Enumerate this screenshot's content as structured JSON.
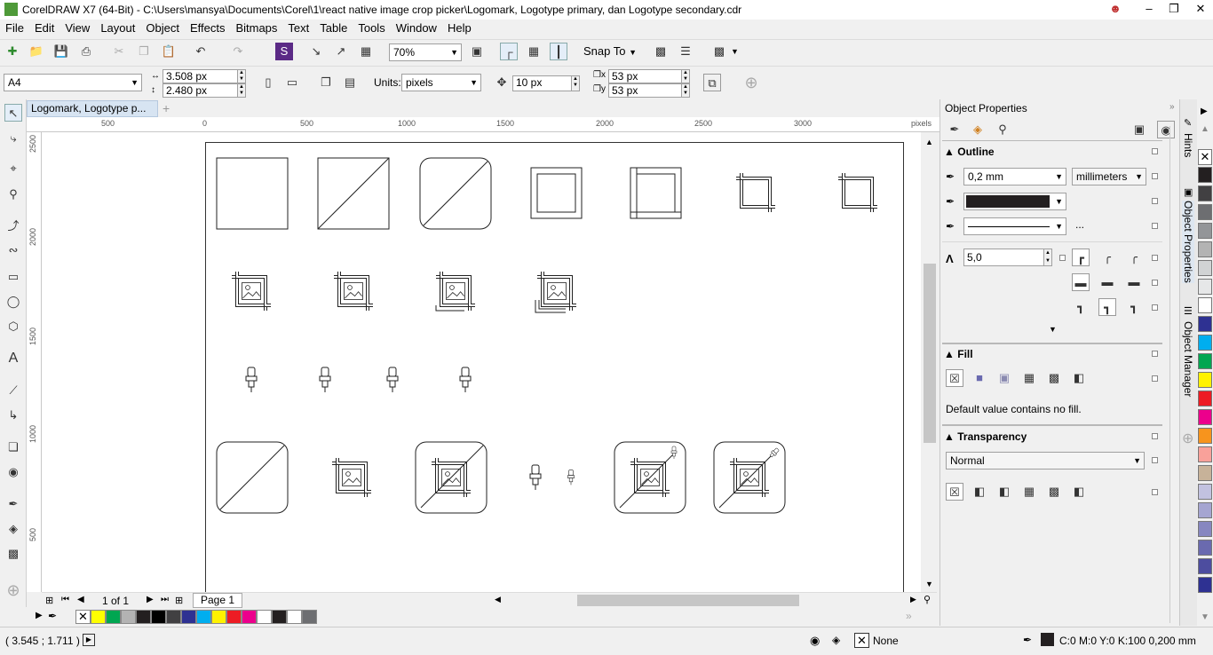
{
  "window": {
    "title": "CorelDRAW X7 (64-Bit) - C:\\Users\\mansya\\Documents\\Corel\\1\\react native image crop picker\\Logomark, Logotype primary, dan Logotype secondary.cdr",
    "controls": [
      "person-icon",
      "minimize-icon",
      "restore-icon",
      "close-icon"
    ]
  },
  "menu": [
    "File",
    "Edit",
    "View",
    "Layout",
    "Object",
    "Effects",
    "Bitmaps",
    "Text",
    "Table",
    "Tools",
    "Window",
    "Help"
  ],
  "toolbar": {
    "zoom": "70%",
    "snap_to": "Snap To"
  },
  "property_bar": {
    "page_size": "A4",
    "width": "3.508 px",
    "height": "2.480 px",
    "units_label": "Units:",
    "units": "pixels",
    "nudge": "10 px",
    "dup_x": "53 px",
    "dup_y": "53 px"
  },
  "document": {
    "tab": "Logomark, Logotype p...",
    "ruler_unit": "pixels",
    "h_ruler": [
      "500",
      "0",
      "500",
      "1000",
      "1500",
      "2000",
      "2500",
      "3000"
    ],
    "v_ruler": [
      "2500",
      "2000",
      "1500",
      "1000",
      "500"
    ],
    "page_counter": "1 of 1",
    "page_tab": "Page 1"
  },
  "object_properties": {
    "title": "Object Properties",
    "outline": {
      "label": "Outline",
      "width": "0,2 mm",
      "units": "millimeters",
      "miter": "5,0",
      "more": "..."
    },
    "fill": {
      "label": "Fill",
      "message": "Default value contains no fill."
    },
    "transparency": {
      "label": "Transparency",
      "mode": "Normal"
    }
  },
  "side_tabs": [
    "Hints",
    "Object Properties",
    "Object Manager"
  ],
  "status": {
    "coords": "( 3.545 ; 1.711 )",
    "fill": "None",
    "outline": "C:0 M:0 Y:0 K:100  0,200 mm"
  },
  "colors": {
    "accent_green": "#4f9a39",
    "outline_color": "#231f20",
    "palette_bottom": [
      "#ffff00",
      "#00a651",
      "#b3b3b3",
      "#231f20",
      "#000000",
      "#414042",
      "#2e3192",
      "#00aeef",
      "#fff200",
      "#ed1c24",
      "#ec008c",
      "#ffffff",
      "#231f20",
      "#ffffff",
      "#6d6e71"
    ],
    "palette_right": [
      "#231f20",
      "#414042",
      "#6d6e71",
      "#939598",
      "#b3b3b3",
      "#d1d3d4",
      "#e6e7e8",
      "#ffffff",
      "#2e3192",
      "#00aeef",
      "#00a651",
      "#fff200",
      "#ed1c24",
      "#ec008c",
      "#f7941d",
      "#f9a19a",
      "#c7b299",
      "#c2c2e0",
      "#a5a5d1",
      "#8787c0",
      "#6a6aaf",
      "#4d4d9f",
      "#2e3192"
    ]
  }
}
